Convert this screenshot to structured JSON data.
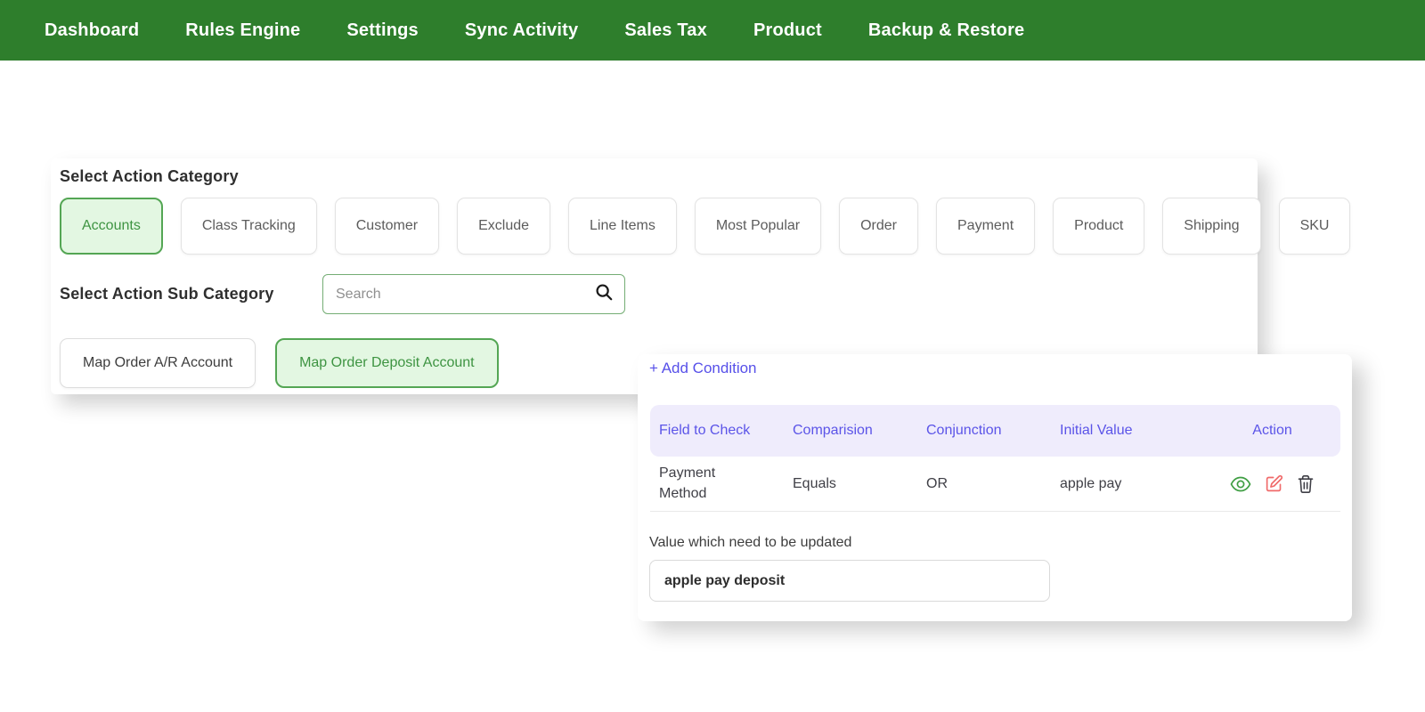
{
  "nav": {
    "items": [
      {
        "label": "Dashboard",
        "active": false
      },
      {
        "label": "Rules Engine",
        "active": true
      },
      {
        "label": "Settings",
        "active": false
      },
      {
        "label": "Sync Activity",
        "active": false
      },
      {
        "label": "Sales Tax",
        "active": false
      },
      {
        "label": "Product",
        "active": false
      },
      {
        "label": "Backup & Restore",
        "active": false
      }
    ]
  },
  "action_category": {
    "title": "Select Action Category",
    "options": [
      {
        "label": "Accounts",
        "selected": true
      },
      {
        "label": "Class Tracking",
        "selected": false
      },
      {
        "label": "Customer",
        "selected": false
      },
      {
        "label": "Exclude",
        "selected": false
      },
      {
        "label": "Line Items",
        "selected": false
      },
      {
        "label": "Most Popular",
        "selected": false
      },
      {
        "label": "Order",
        "selected": false
      },
      {
        "label": "Payment",
        "selected": false
      },
      {
        "label": "Product",
        "selected": false
      },
      {
        "label": "Shipping",
        "selected": false
      },
      {
        "label": "SKU",
        "selected": false
      }
    ]
  },
  "sub_category": {
    "title": "Select Action Sub Category",
    "search": {
      "placeholder": "Search",
      "icon": "search-icon"
    },
    "options": [
      {
        "label": "Map Order A/R Account",
        "selected": false
      },
      {
        "label": "Map Order Deposit Account",
        "selected": true
      }
    ]
  },
  "conditions": {
    "add_button_label": "+ Add Condition",
    "table": {
      "headers": [
        "Field to Check",
        "Comparision",
        "Conjunction",
        "Initial Value",
        "Action"
      ],
      "rows": [
        {
          "field_to_check": "Payment Method",
          "comparision": "Equals",
          "conjunction": "OR",
          "initial_value": "apple pay",
          "action_icons": [
            "view-icon",
            "edit-icon",
            "delete-icon"
          ]
        }
      ]
    },
    "value_label": "Value which need to be updated",
    "value_input": "apple pay deposit"
  },
  "colors": {
    "nav_background": "#2e7e2c",
    "selected_chip_background": "#e3f7e2",
    "selected_chip_border": "#54a654",
    "selected_chip_text": "#3e9442",
    "search_border_green": "#74ad74",
    "accent_purple": "#5750e9",
    "table_header_background": "#efecfc",
    "table_header_text": "#5b54e8",
    "view_icon_green": "#3f9e43",
    "edit_icon_red": "#f06a6a",
    "delete_icon_dark": "#3f3f46"
  }
}
